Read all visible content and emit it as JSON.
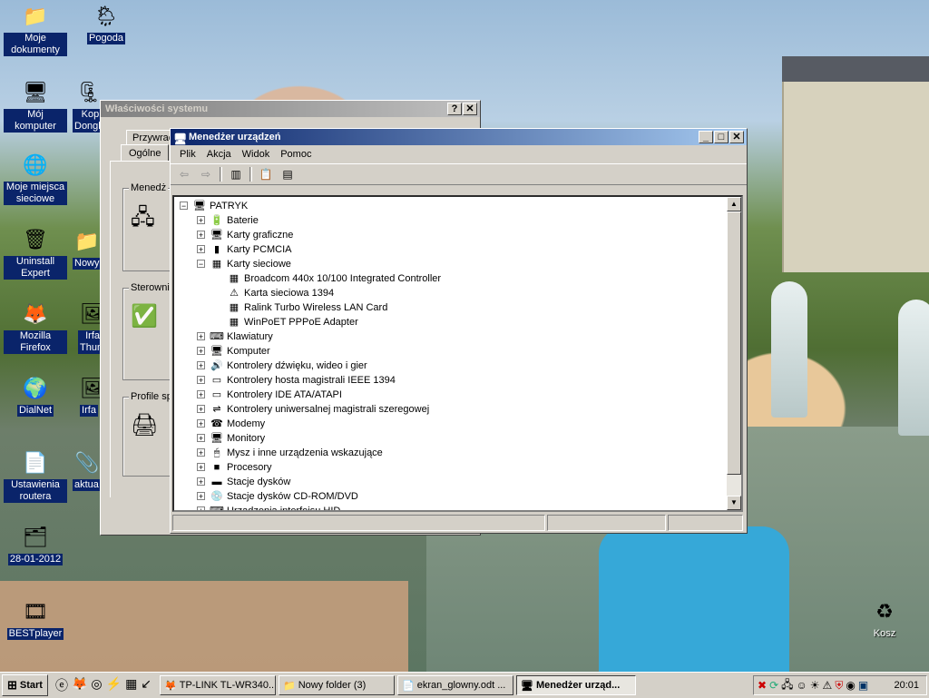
{
  "desktop": {
    "icons": [
      {
        "label": "Moje dokumenty",
        "icon": "folder-icon",
        "glyph": "📁",
        "selected": true
      },
      {
        "label": "Pogoda",
        "icon": "weather-icon",
        "glyph": "🌦"
      },
      {
        "label": "Mój komputer",
        "icon": "computer-icon",
        "glyph": "🖥",
        "selected": true
      },
      {
        "label": "Kop Dongle",
        "icon": "archive-icon",
        "glyph": "🗜",
        "selected": true
      },
      {
        "label": "Moje miejsca sieciowe",
        "icon": "network-places-icon",
        "glyph": "🌐",
        "selected": true
      },
      {
        "label": "Uninstall Expert",
        "icon": "uninstall-icon",
        "glyph": "🗑",
        "selected": true
      },
      {
        "label": "Nowy",
        "icon": "folder-icon",
        "glyph": "📁",
        "selected": true
      },
      {
        "label": "Mozilla Firefox",
        "icon": "firefox-icon",
        "glyph": "🦊",
        "selected": true
      },
      {
        "label": "Irfa Thum",
        "icon": "irfanview-icon",
        "glyph": "🖼",
        "selected": true
      },
      {
        "label": "DialNet",
        "icon": "dialnet-icon",
        "glyph": "🌍",
        "selected": true
      },
      {
        "label": "Irfa",
        "icon": "irfanview-icon",
        "glyph": "🖼",
        "selected": true
      },
      {
        "label": "Ustawienia routera",
        "icon": "document-icon",
        "glyph": "📄",
        "selected": true
      },
      {
        "label": "aktua",
        "icon": "shortcut-icon",
        "glyph": "📎",
        "selected": true
      },
      {
        "label": "28-01-2012",
        "icon": "archive-icon",
        "glyph": "🗂",
        "selected": true
      },
      {
        "label": "BESTplayer",
        "icon": "media-player-icon",
        "glyph": "🎞",
        "selected": true
      },
      {
        "label": "Kosz",
        "icon": "recycle-bin-icon",
        "glyph": "♻"
      }
    ]
  },
  "sysprops": {
    "title": "Właściwości systemu",
    "help_btn": "?",
    "close_btn": "✕",
    "tabs": {
      "przywracanie": "Przywrac",
      "ogolne": "Ogólne"
    },
    "groups": {
      "menedzer": "Menedż",
      "sterowniki": "Sterownik",
      "profile": "Profile sp"
    }
  },
  "devmgr": {
    "title": "Menedżer urządzeń",
    "caption_buttons": {
      "minimize": "_",
      "maximize": "□",
      "close": "✕"
    },
    "menu": {
      "plik": "Plik",
      "akcja": "Akcja",
      "widok": "Widok",
      "pomoc": "Pomoc"
    },
    "toolbar_icons": [
      "back-arrow-icon",
      "forward-arrow-icon",
      "show-hide-tree-icon",
      "properties-icon",
      "help-icon"
    ],
    "root": "PATRYK",
    "tree": [
      {
        "label": "Baterie",
        "icon": "battery-icon",
        "glyph": "🔋"
      },
      {
        "label": "Karty graficzne",
        "icon": "display-adapter-icon",
        "glyph": "🖥"
      },
      {
        "label": "Karty PCMCIA",
        "icon": "pcmcia-icon",
        "glyph": "▮"
      },
      {
        "label": "Karty sieciowe",
        "icon": "network-card-icon",
        "glyph": "▦",
        "expanded": true,
        "children": [
          {
            "label": "Broadcom 440x 10/100 Integrated Controller",
            "icon": "network-card-icon",
            "glyph": "▦"
          },
          {
            "label": "Karta sieciowa 1394",
            "icon": "network-card-warning-icon",
            "glyph": "⚠"
          },
          {
            "label": "Ralink Turbo Wireless LAN Card",
            "icon": "network-card-icon",
            "glyph": "▦"
          },
          {
            "label": "WinPoET PPPoE Adapter",
            "icon": "network-card-icon",
            "glyph": "▦"
          }
        ]
      },
      {
        "label": "Klawiatury",
        "icon": "keyboard-icon",
        "glyph": "⌨"
      },
      {
        "label": "Komputer",
        "icon": "computer-icon",
        "glyph": "🖥"
      },
      {
        "label": "Kontrolery dźwięku, wideo i gier",
        "icon": "sound-icon",
        "glyph": "🔊"
      },
      {
        "label": "Kontrolery hosta magistrali IEEE 1394",
        "icon": "ieee1394-icon",
        "glyph": "▭"
      },
      {
        "label": "Kontrolery IDE ATA/ATAPI",
        "icon": "ide-controller-icon",
        "glyph": "▭"
      },
      {
        "label": "Kontrolery uniwersalnej magistrali szeregowej",
        "icon": "usb-icon",
        "glyph": "⇌"
      },
      {
        "label": "Modemy",
        "icon": "modem-icon",
        "glyph": "☎"
      },
      {
        "label": "Monitory",
        "icon": "monitor-icon",
        "glyph": "🖥"
      },
      {
        "label": "Mysz i inne urządzenia wskazujące",
        "icon": "mouse-icon",
        "glyph": "🖱"
      },
      {
        "label": "Procesory",
        "icon": "processor-icon",
        "glyph": "■"
      },
      {
        "label": "Stacje dysków",
        "icon": "disk-drive-icon",
        "glyph": "▬"
      },
      {
        "label": "Stacje dysków CD-ROM/DVD",
        "icon": "cdrom-icon",
        "glyph": "💿"
      },
      {
        "label": "Urządzenia interfejsu HID",
        "icon": "hid-icon",
        "glyph": "⌨"
      }
    ]
  },
  "taskbar": {
    "start": "Start",
    "quicklaunch": [
      "ie-icon",
      "firefox-icon",
      "opera-icon",
      "winamp-icon",
      "notepad-icon",
      "arrow-icon"
    ],
    "tasks": [
      {
        "label": "TP-LINK TL-WR340...",
        "icon": "firefox-icon",
        "glyph": "🦊",
        "active": false
      },
      {
        "label": "Nowy folder (3)",
        "icon": "folder-icon",
        "glyph": "📁",
        "active": false
      },
      {
        "label": "ekran_glowny.odt ...",
        "icon": "document-icon",
        "glyph": "📄",
        "active": false
      },
      {
        "label": "Menedżer urząd...",
        "icon": "device-manager-icon",
        "glyph": "🖥",
        "active": true
      }
    ],
    "tray_icons": [
      "network-error-icon",
      "update-icon",
      "network-icon",
      "messenger-icon",
      "weather-icon",
      "warning-icon",
      "antivirus-icon",
      "shield-icon",
      "language-icon"
    ],
    "clock": "20:01"
  }
}
